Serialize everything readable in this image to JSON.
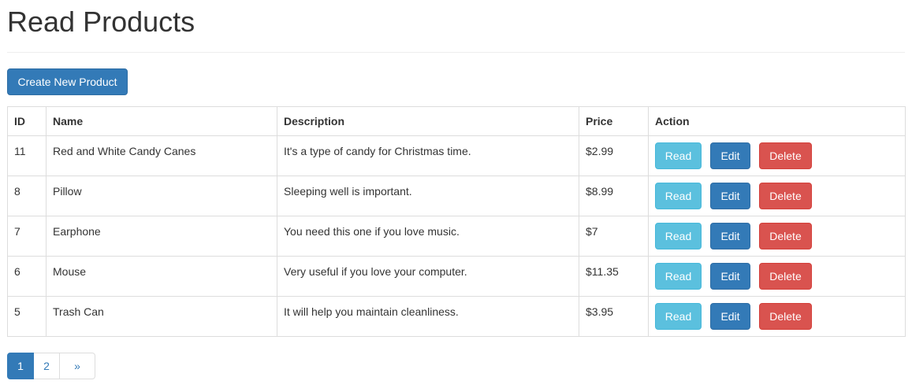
{
  "page": {
    "title": "Read Products"
  },
  "toolbar": {
    "create_label": "Create New Product"
  },
  "table": {
    "headers": {
      "id": "ID",
      "name": "Name",
      "description": "Description",
      "price": "Price",
      "action": "Action"
    },
    "rows": [
      {
        "id": "11",
        "name": "Red and White Candy Canes",
        "description": "It's a type of candy for Christmas time.",
        "price": "$2.99"
      },
      {
        "id": "8",
        "name": "Pillow",
        "description": "Sleeping well is important.",
        "price": "$8.99"
      },
      {
        "id": "7",
        "name": "Earphone",
        "description": "You need this one if you love music.",
        "price": "$7"
      },
      {
        "id": "6",
        "name": "Mouse",
        "description": "Very useful if you love your computer.",
        "price": "$11.35"
      },
      {
        "id": "5",
        "name": "Trash Can",
        "description": "It will help you maintain cleanliness.",
        "price": "$3.95"
      }
    ],
    "row_actions": {
      "read": "Read",
      "edit": "Edit",
      "delete": "Delete"
    }
  },
  "pagination": {
    "pages": [
      "1",
      "2"
    ],
    "active": "1",
    "next": "»"
  },
  "colors": {
    "primary": "#337ab7",
    "info": "#5bc0de",
    "danger": "#d9534f",
    "border": "#dddddd",
    "text": "#333333"
  }
}
